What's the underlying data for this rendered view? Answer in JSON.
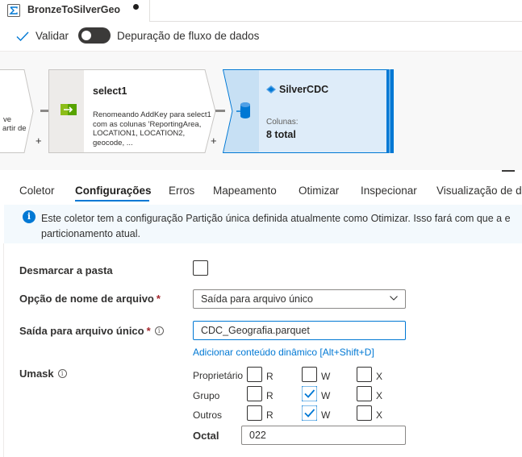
{
  "doc_tab": {
    "title": "BronzeToSilverGeo",
    "icon": "dataflow-sigma-icon"
  },
  "toolbar": {
    "validate_label": "Validar",
    "debug_toggle_on": false,
    "debug_label": "Depuração de fluxo de dados"
  },
  "canvas": {
    "left_node": {
      "text_line1": "ve",
      "text_line2": "artir de"
    },
    "select_node": {
      "name": "select1",
      "description": "Renomeando AddKey para select1 com as colunas 'ReportingArea, LOCATION1, LOCATION2, geocode, ..."
    },
    "sink_node": {
      "name": "SilverCDC",
      "columns_label": "Colunas:",
      "columns_total": "8 total"
    },
    "plus": "+"
  },
  "tabs": [
    {
      "label": "Coletor",
      "active": false
    },
    {
      "label": "Configurações",
      "active": true
    },
    {
      "label": "Erros",
      "active": false
    },
    {
      "label": "Mapeamento",
      "active": false
    },
    {
      "label": "Otimizar",
      "active": false
    },
    {
      "label": "Inspecionar",
      "active": false
    },
    {
      "label": "Visualização de d",
      "active": false
    }
  ],
  "info_bar": {
    "line1": "Este coletor tem a configuração Partição única definida atualmente como Otimizar. Isso fará com que a e",
    "line2": "particionamento atual."
  },
  "form": {
    "clear_folder": {
      "label": "Desmarcar a pasta",
      "checked": false
    },
    "file_name_option": {
      "label": "Opção de nome de arquivo",
      "required_mark": "*",
      "value": "Saída para arquivo único"
    },
    "single_file_output": {
      "label": "Saída para arquivo único",
      "required_mark": "*",
      "value": "CDC_Geografia.parquet",
      "dynamic_link": "Adicionar conteúdo dinâmico [Alt+Shift+D]"
    },
    "umask": {
      "label": "Umask",
      "rows": [
        {
          "label": "Proprietário",
          "r": false,
          "w": false,
          "x": false
        },
        {
          "label": "Grupo",
          "r": false,
          "w": true,
          "x": false
        },
        {
          "label": "Outros",
          "r": false,
          "w": true,
          "x": false
        }
      ],
      "letters": {
        "r": "R",
        "w": "W",
        "x": "X"
      },
      "octal_label": "Octal",
      "octal_value": "022"
    }
  },
  "colors": {
    "accent": "#0078d4",
    "info_bg": "#f3f9fd",
    "toggle_off": "#3b3a39"
  }
}
